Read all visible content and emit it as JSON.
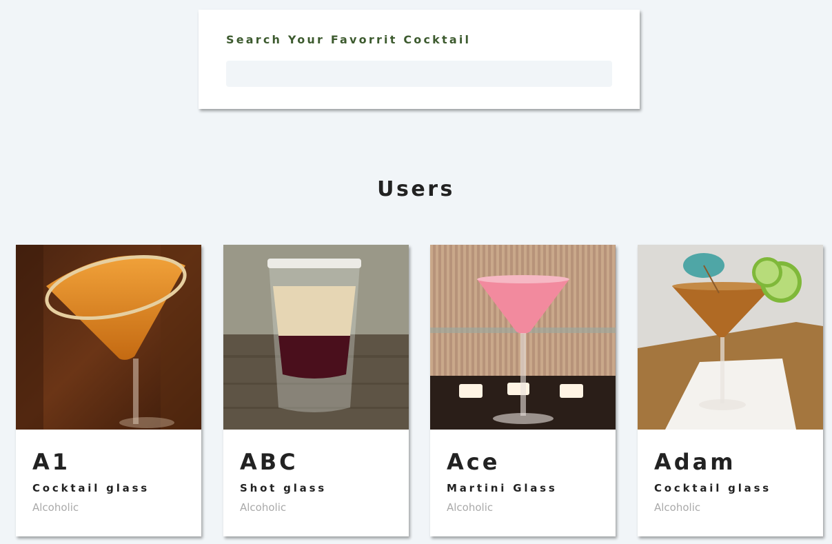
{
  "search": {
    "label": "Search Your Favorrit Cocktail",
    "value": "",
    "placeholder": ""
  },
  "section": {
    "title": "Users"
  },
  "cocktails": [
    {
      "name": "A1",
      "glass": "Cocktail glass",
      "type": "Alcoholic",
      "image": "orange-martini-with-sugar-rim"
    },
    {
      "name": "ABC",
      "glass": "Shot glass",
      "type": "Alcoholic",
      "image": "layered-shot-glass"
    },
    {
      "name": "Ace",
      "glass": "Martini Glass",
      "type": "Alcoholic",
      "image": "pink-martini-with-candles"
    },
    {
      "name": "Adam",
      "glass": "Cocktail glass",
      "type": "Alcoholic",
      "image": "amber-martini-with-lime-and-umbrella"
    }
  ],
  "colors": {
    "page_background": "#f1f5f8",
    "search_label": "#3c5a2e",
    "heading": "#222222",
    "muted_text": "#a9a9a9"
  }
}
